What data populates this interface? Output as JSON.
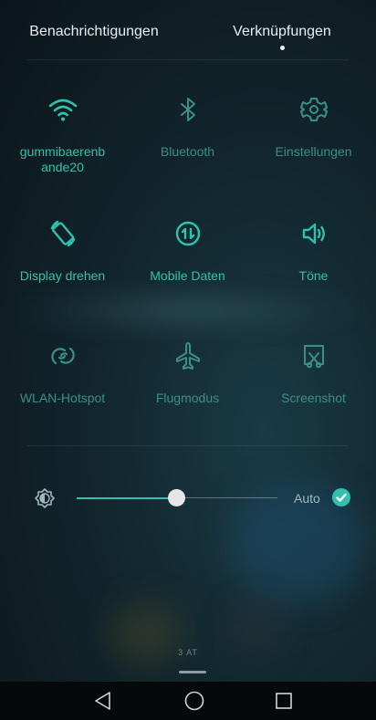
{
  "tabs": [
    {
      "label": "Benachrichtigungen",
      "active": false
    },
    {
      "label": "Verknüpfungen",
      "active": true
    }
  ],
  "toggles": [
    {
      "label": "gummibaerenb\nande20",
      "icon": "wifi-icon",
      "state": "on"
    },
    {
      "label": "Bluetooth",
      "icon": "bluetooth-icon",
      "state": "off"
    },
    {
      "label": "Einstellungen",
      "icon": "gear-icon",
      "state": "off"
    },
    {
      "label": "Display drehen",
      "icon": "rotate-screen-icon",
      "state": "on"
    },
    {
      "label": "Mobile Daten",
      "icon": "mobile-data-icon",
      "state": "on"
    },
    {
      "label": "Töne",
      "icon": "speaker-icon",
      "state": "on"
    },
    {
      "label": "WLAN-Hotspot",
      "icon": "hotspot-icon",
      "state": "off"
    },
    {
      "label": "Flugmodus",
      "icon": "airplane-icon",
      "state": "off"
    },
    {
      "label": "Screenshot",
      "icon": "screenshot-icon",
      "state": "off"
    }
  ],
  "brightness": {
    "icon": "brightness-icon",
    "level": 0.5,
    "auto_label": "Auto",
    "auto_checked": true
  },
  "carrier_text": "3 AT",
  "navbar": {
    "back_icon": "back-icon",
    "home_icon": "home-icon",
    "recents_icon": "recents-icon"
  },
  "colors": {
    "accent": "#2fc1ad",
    "accent_dim": "#3a8f86",
    "background": "#12262d",
    "navbar": "#060909"
  }
}
